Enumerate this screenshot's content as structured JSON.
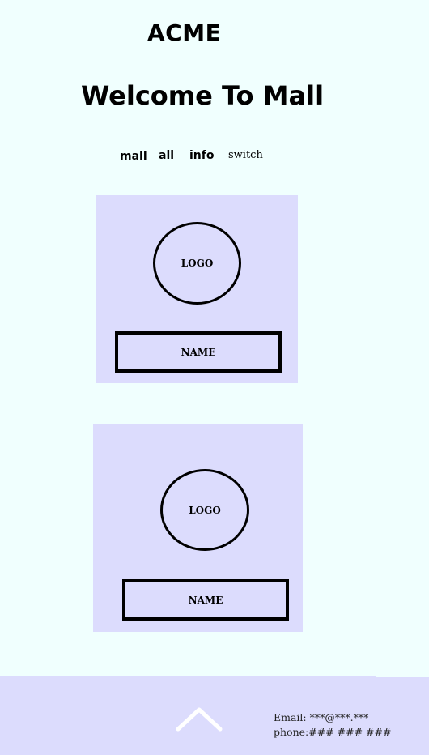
{
  "header": {
    "brand": "ACME",
    "headline": "Welcome To Mall"
  },
  "nav": {
    "items": [
      {
        "label": "mall"
      },
      {
        "label": "all"
      },
      {
        "label": "info"
      },
      {
        "label": "switch"
      }
    ]
  },
  "cards": [
    {
      "logo_text": "LOGO",
      "name_text": "NAME"
    },
    {
      "logo_text": "LOGO",
      "name_text": "NAME"
    }
  ],
  "footer": {
    "scroll_top_icon": "chevron-up-icon",
    "email_line": "Email: ***@***.***",
    "phone_line": "phone:### ### ###"
  },
  "colors": {
    "page_background": "#F0FFFE",
    "card_background": "#DCDCFD",
    "footer_background": "#DCDCFD",
    "chevron": "#FFFFFF"
  }
}
